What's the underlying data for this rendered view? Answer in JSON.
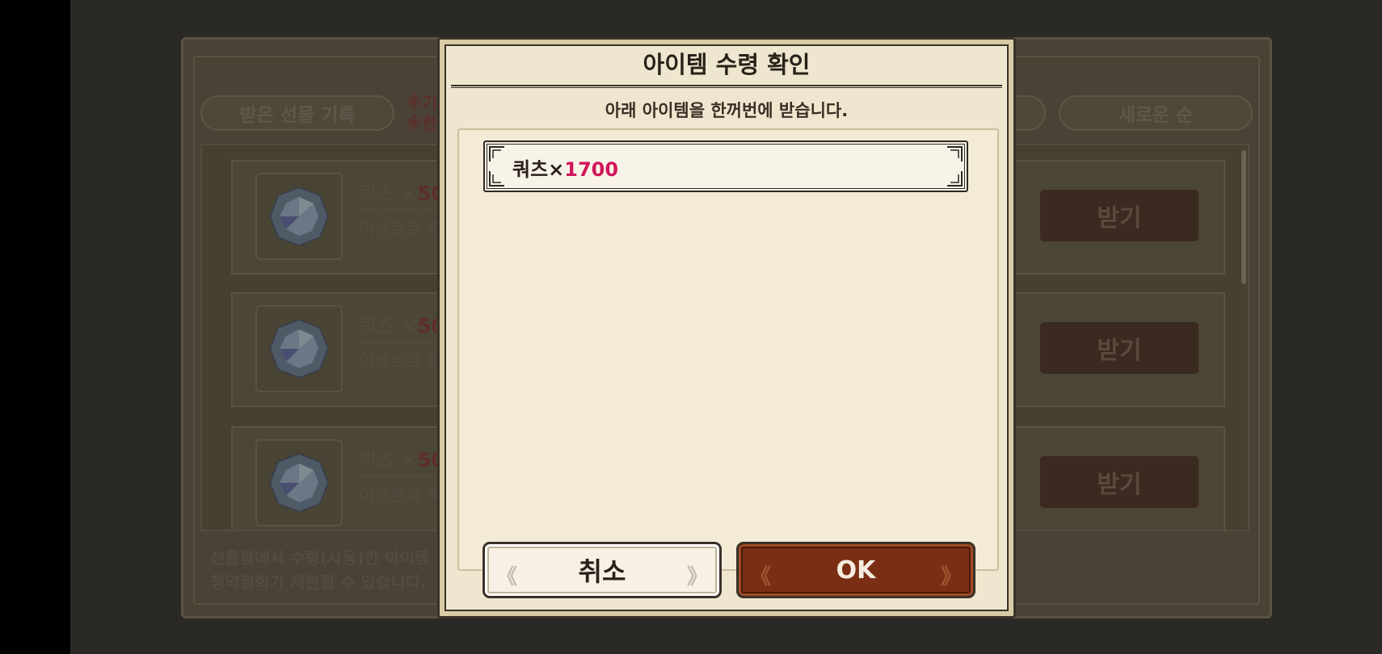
{
  "background": {
    "tabs": {
      "history": "받은 선물 기록",
      "sort": "새로운 순"
    },
    "notice_lines": [
      "※기",
      "※한"
    ],
    "rows": [
      {
        "title": "쿼츠 ×",
        "qty": "50",
        "desc": "이벤트로 획",
        "button": "받기"
      },
      {
        "title": "쿼츠 ×",
        "qty": "50",
        "desc": "이벤트로 획",
        "button": "받기"
      },
      {
        "title": "쿼츠 ×",
        "qty": "50",
        "desc": "이벤트로 획",
        "button": "받기"
      }
    ],
    "footer_lines": [
      "선물함에서 수령(사용)한 아이템",
      "청약철회가 제한될 수 있습니다."
    ]
  },
  "dialog": {
    "title": "아이템 수령 확인",
    "subtitle": "아래 아이템을 한꺼번에 받습니다.",
    "item": {
      "name": "쿼츠×",
      "qty": "1700"
    },
    "cancel_label": "취소",
    "ok_label": "OK"
  },
  "colors": {
    "highlight_qty": "#d2155a",
    "ok_button": "#7a2e14",
    "dialog_bg": "#efe6cf"
  }
}
